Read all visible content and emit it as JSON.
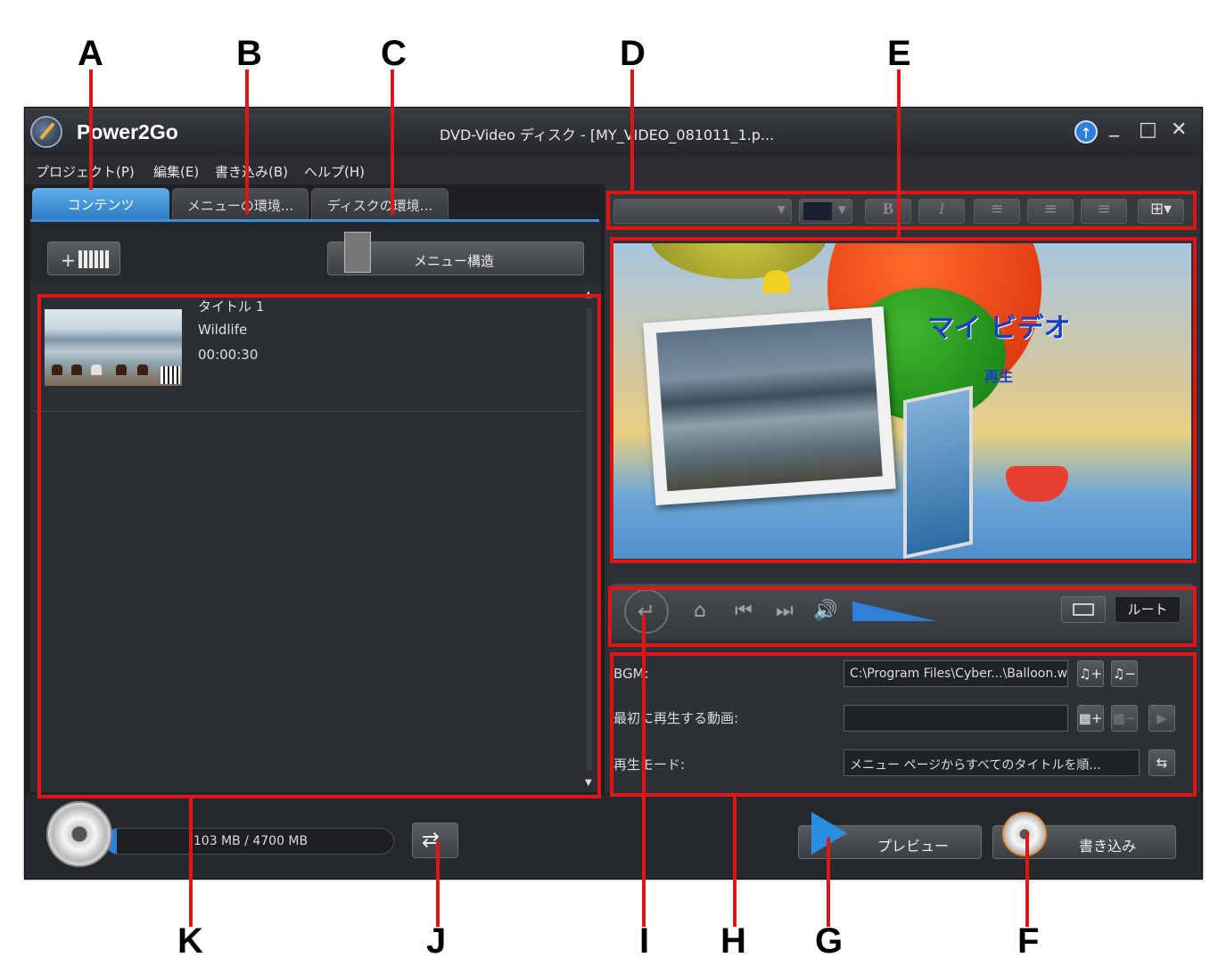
{
  "callouts": {
    "A": "A",
    "B": "B",
    "C": "C",
    "D": "D",
    "E": "E",
    "F": "F",
    "G": "G",
    "H": "H",
    "I": "I",
    "J": "J",
    "K": "K"
  },
  "window": {
    "app_name": "Power2Go",
    "title": "DVD-Video ディスク - [MY_VIDEO_081011_1.p...",
    "controls": {
      "minimize": "_",
      "maximize": "□",
      "close": "✕"
    }
  },
  "menu": {
    "items": [
      "プロジェクト(P)",
      "編集(E)",
      "書き込み(B)",
      "ヘルプ(H)"
    ]
  },
  "tabs": [
    "コンテンツ",
    "メニューの環境...",
    "ディスクの環境..."
  ],
  "toolbar": {
    "add_label": "+",
    "menu_structure_label": "メニュー構造"
  },
  "content_list": [
    {
      "title": "タイトル 1",
      "name": "Wildlife",
      "duration": "00:00:30"
    }
  ],
  "preview": {
    "menu_title": "マイ ビデオ",
    "menu_play": "再生"
  },
  "format_bar": {
    "bold": "B",
    "italic": "I"
  },
  "navigation": {
    "root_label": "ルート"
  },
  "settings": {
    "bgm_label": "BGM:",
    "bgm_value": "C:\\Program Files\\Cyber...\\Balloon.wma",
    "first_play_label": "最初に再生する動画:",
    "first_play_value": "",
    "play_mode_label": "再生モード:",
    "play_mode_value": "メニュー ページからすべてのタイトルを順..."
  },
  "status": {
    "capacity_text": "103 MB / 4700 MB",
    "capacity_fraction": 0.022
  },
  "actions": {
    "preview_label": "プレビュー",
    "burn_label": "書き込み"
  },
  "colors": {
    "callout_red": "#e01515",
    "accent_blue": "#2f7fd8"
  }
}
